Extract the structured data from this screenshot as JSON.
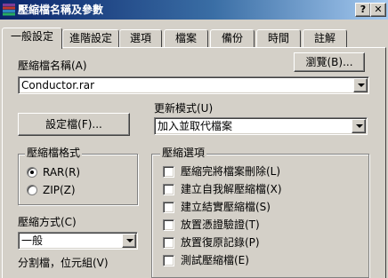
{
  "window": {
    "title": "壓縮檔名稱及參數",
    "help_button": "?",
    "close_button": "✕"
  },
  "tabs": [
    {
      "label": "一般設定",
      "active": true
    },
    {
      "label": "進階設定"
    },
    {
      "label": "選項"
    },
    {
      "label": "檔案"
    },
    {
      "label": "備份"
    },
    {
      "label": "時間"
    },
    {
      "label": "註解"
    }
  ],
  "archive_name": {
    "label": "壓縮檔名稱(A)",
    "browse_button": "瀏覽(B)...",
    "value": "Conductor.rar"
  },
  "profiles_button": "設定檔(F)...",
  "update_mode": {
    "label": "更新模式(U)",
    "value": "加入並取代檔案"
  },
  "archive_format": {
    "title": "壓縮檔格式",
    "options": [
      {
        "label": "RAR(R)",
        "selected": true
      },
      {
        "label": "ZIP(Z)",
        "selected": false
      }
    ]
  },
  "compression_method": {
    "label": "壓縮方式(C)",
    "value": "一般"
  },
  "split_label": "分割檔，位元組(V)",
  "archiving_options": {
    "title": "壓縮選項",
    "items": [
      {
        "label": "壓縮完將檔案刪除(L)",
        "checked": false
      },
      {
        "label": "建立自我解壓縮檔(X)",
        "checked": false
      },
      {
        "label": "建立結實壓縮檔(S)",
        "checked": false
      },
      {
        "label": "放置憑證驗證(T)",
        "checked": false
      },
      {
        "label": "放置復原記錄(P)",
        "checked": false
      },
      {
        "label": "測試壓縮檔(E)",
        "checked": false
      }
    ]
  }
}
